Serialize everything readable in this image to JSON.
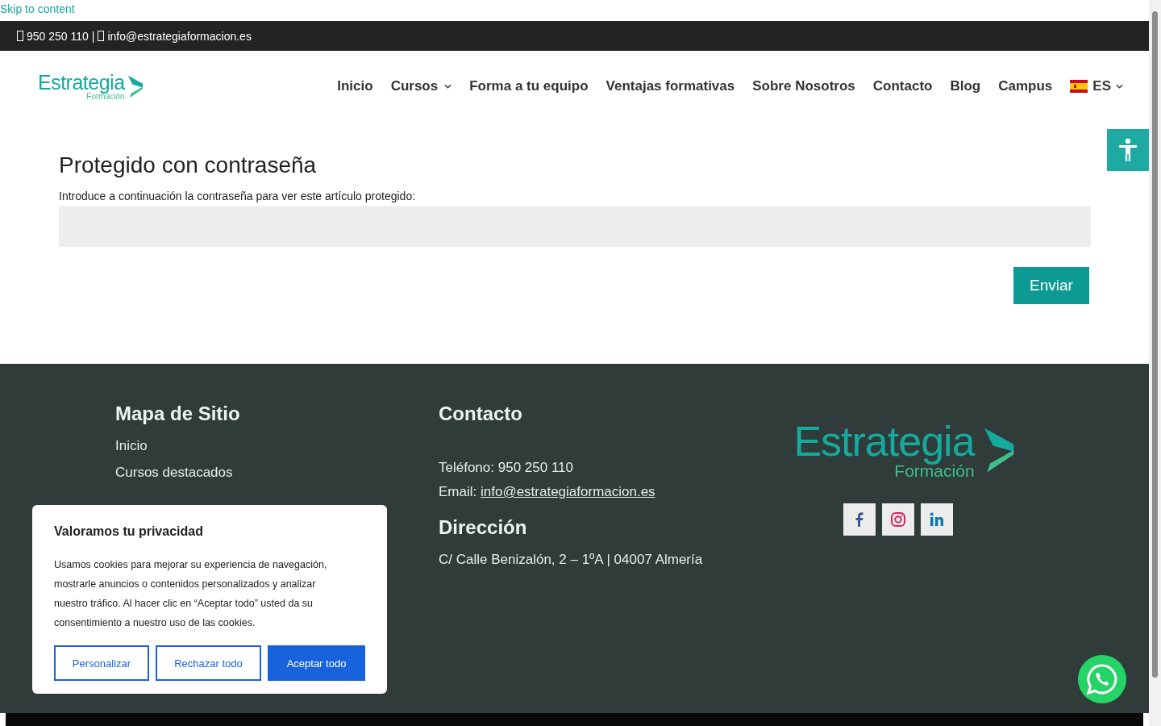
{
  "skip_link": "Skip to content",
  "top_bar": {
    "phone": "950 250 110",
    "separator": "|",
    "email": "info@estrategiaformacion.es"
  },
  "header": {
    "logo": {
      "name": "Estrategia",
      "subtitle": "Formación"
    },
    "nav": [
      {
        "label": "Inicio",
        "has_submenu": false
      },
      {
        "label": "Cursos",
        "has_submenu": true
      },
      {
        "label": "Forma a tu equipo",
        "has_submenu": false
      },
      {
        "label": "Ventajas formativas",
        "has_submenu": false
      },
      {
        "label": "Sobre Nosotros",
        "has_submenu": false
      },
      {
        "label": "Contacto",
        "has_submenu": false
      },
      {
        "label": "Blog",
        "has_submenu": false
      },
      {
        "label": "Campus",
        "has_submenu": false
      }
    ],
    "language": {
      "label": "ES"
    }
  },
  "password_form": {
    "title": "Protegido con contraseña",
    "instructions": "Introduce a continuación la contraseña para ver este artículo protegido:",
    "submit": "Enviar"
  },
  "footer": {
    "sitemap": {
      "title": "Mapa de Sitio",
      "links": [
        "Inicio",
        "Cursos destacados"
      ]
    },
    "contact": {
      "title": "Contacto",
      "phone_label": "Teléfono:",
      "phone": "950 250 110",
      "email_label": "Email:",
      "email": "info@estrategiaformacion.es",
      "address_title": "Dirección",
      "address": "C/ Calle Benizalón, 2 – 1ºA | 04007 Almería"
    },
    "logo": {
      "name": "Estrategia",
      "subtitle": "Formación"
    },
    "social": [
      {
        "kind": "facebook"
      },
      {
        "kind": "instagram"
      },
      {
        "kind": "linkedin"
      }
    ]
  },
  "cookie_banner": {
    "title": "Valoramos tu privacidad",
    "text": "Usamos cookies para mejorar su experiencia de navegación, mostrarle anuncios o contenidos personalizados y analizar nuestro tráfico. Al hacer clic en “Aceptar todo” usted da su consentimiento a nuestro uso de las cookies.",
    "buttons": [
      {
        "label": "Personalizar",
        "primary": false
      },
      {
        "label": "Rechazar todo",
        "primary": false
      },
      {
        "label": "Aceptar todo",
        "primary": true
      }
    ]
  }
}
